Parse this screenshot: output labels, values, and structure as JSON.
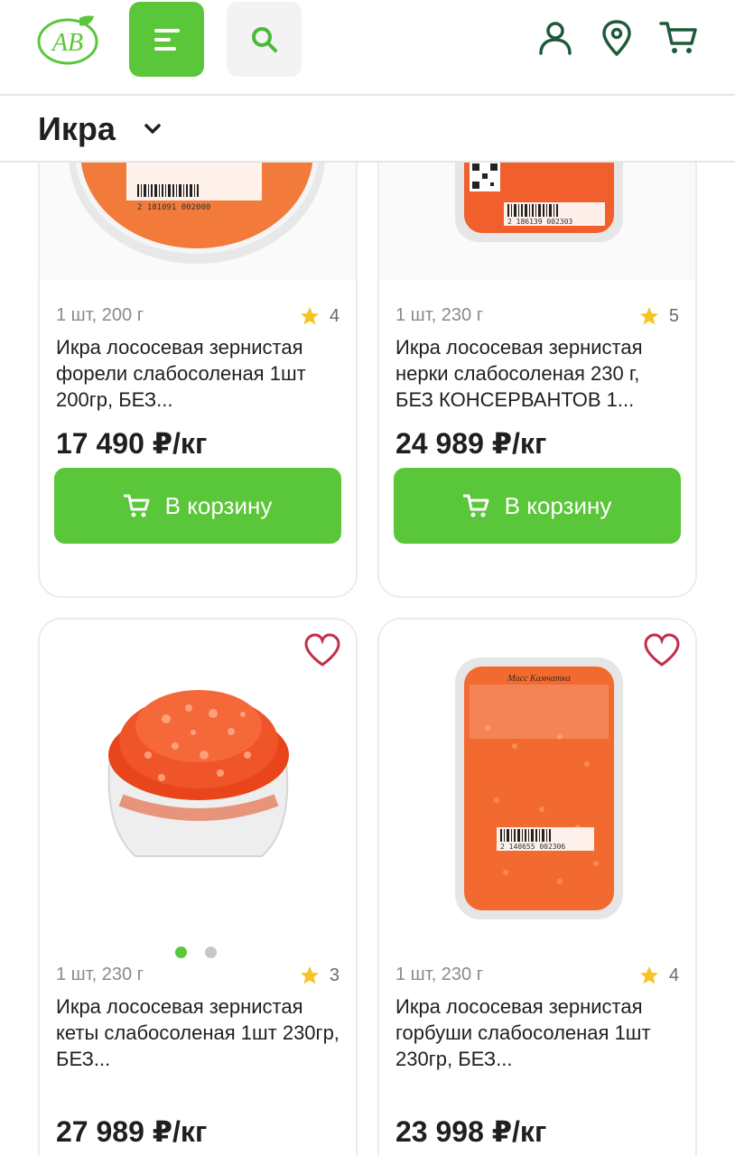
{
  "header": {
    "logo_text": "АВ",
    "colors": {
      "brand_green": "#5ac63a",
      "icon_dark": "#1e5a3a"
    },
    "icons": [
      "logo-icon",
      "menu-icon",
      "search-icon",
      "user-icon",
      "location-icon",
      "cart-icon"
    ]
  },
  "category": {
    "title": "Икра"
  },
  "products": [
    {
      "meta": "1 шт, 200 г",
      "rating": "4",
      "name": "Икра лососевая зернистая форели слабосоленая 1шт 200гр, БЕЗ...",
      "price": "17 490 ₽/кг",
      "cart_label": "В корзину"
    },
    {
      "meta": "1 шт, 230 г",
      "rating": "5",
      "name": "Икра лососевая зернистая нерки слабосоленая 230 г, БЕЗ КОНСЕРВАНТОВ 1...",
      "price": "24 989 ₽/кг",
      "cart_label": "В корзину"
    },
    {
      "meta": "1 шт, 230 г",
      "rating": "3",
      "name": "Икра лососевая зернистая кеты слабосоленая 1шт 230гр, БЕЗ...",
      "price": "27 989 ₽/кг"
    },
    {
      "meta": "1 шт, 230 г",
      "rating": "4",
      "name": "Икра лососевая зернистая горбуши слабосоленая 1шт 230гр, БЕЗ...",
      "price": "23 998 ₽/кг"
    }
  ],
  "package_labels": {
    "barcode_1": "2 181091 002000",
    "barcode_2": "2 186139 002303",
    "barcode_4": "2 140655 002306",
    "brand_4": "Мисс Камчатка"
  },
  "carousel": {
    "total_slides": 2,
    "active_index": 0
  }
}
